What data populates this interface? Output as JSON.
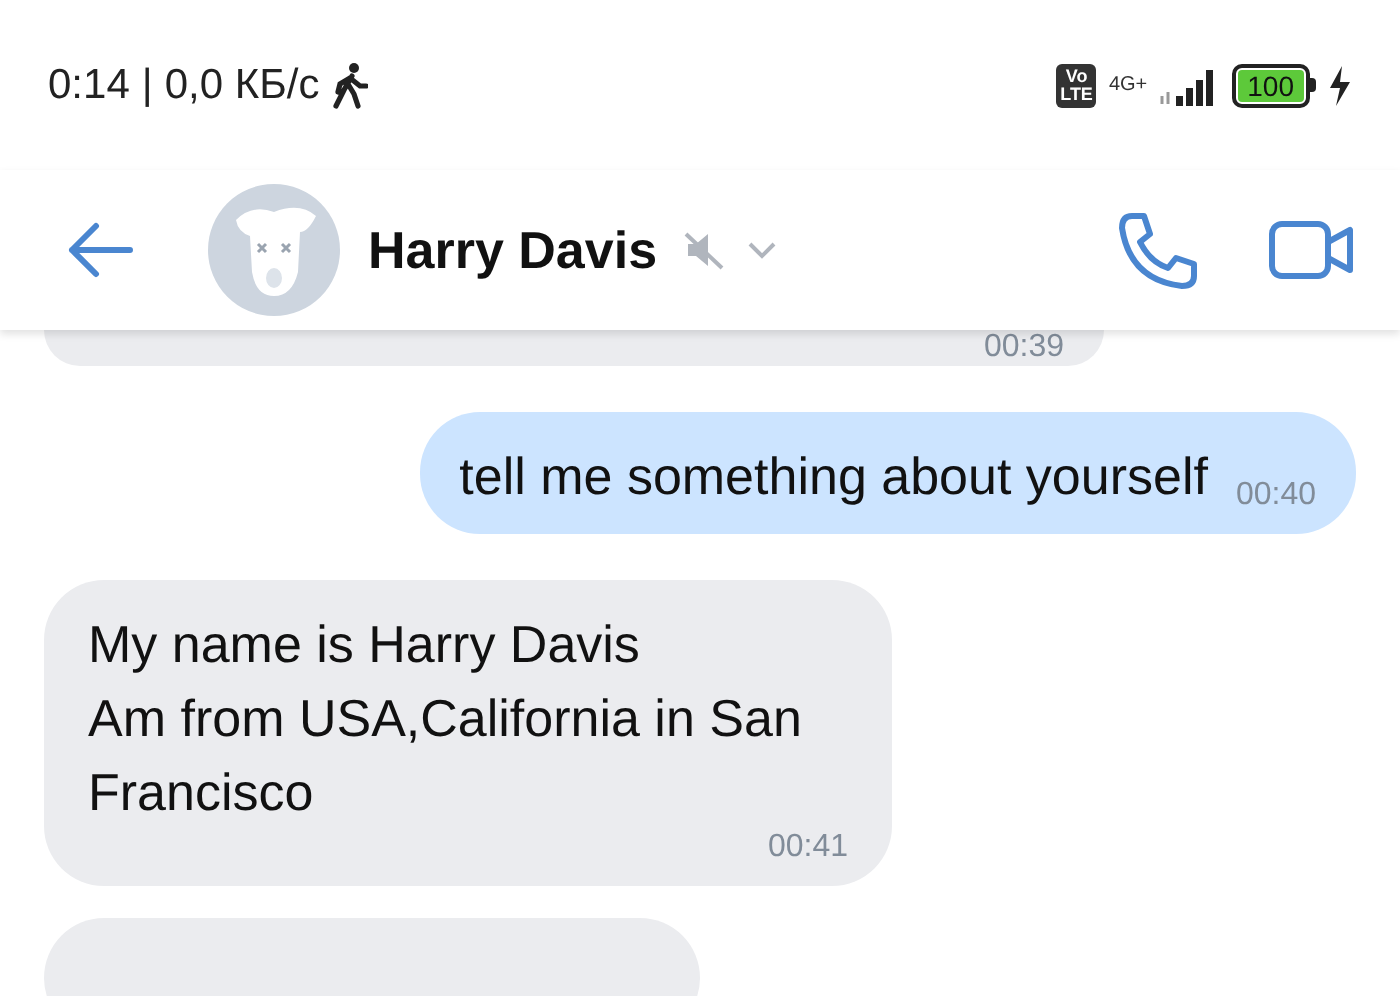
{
  "status_bar": {
    "time": "0:14",
    "separator": "|",
    "speed": "0,0 КБ/с",
    "network_badge": "Vo\nLTE",
    "network_type": "4G+",
    "battery": "100"
  },
  "header": {
    "name": "Harry Davis",
    "muted": true
  },
  "messages": [
    {
      "kind": "incoming",
      "time": "00:39"
    },
    {
      "kind": "outgoing",
      "text": "tell me something about yourself",
      "time": "00:40"
    },
    {
      "kind": "incoming",
      "text": "My name is Harry Davis\nAm from USA,California in San Francisco",
      "time": "00:41"
    },
    {
      "kind": "incoming"
    }
  ]
}
